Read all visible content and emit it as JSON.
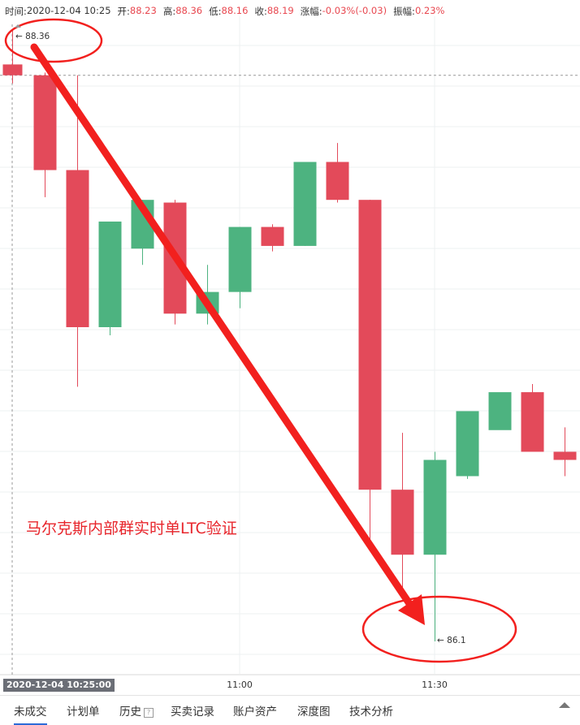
{
  "info_bar": {
    "time_label": "时间:",
    "time_value": "2020-12-04 10:25",
    "open_label": "开:",
    "open_value": "88.23",
    "high_label": "高:",
    "high_value": "88.36",
    "low_label": "低:",
    "low_value": "88.16",
    "close_label": "收:",
    "close_value": "88.19",
    "change_label": "涨幅:",
    "change_value": "-0.03%(-0.03)",
    "amp_label": "振幅:",
    "amp_value": "0.23%"
  },
  "crosshair_time": "2020-12-04 10:25:00",
  "high_marker": "← 88.36",
  "low_marker": "← 86.1",
  "watermark": "马尔克斯内部群实时单LTC验证",
  "colors": {
    "up": "#4db380",
    "down": "#e34a5a",
    "annotation": "#f2201e"
  },
  "tabs": [
    {
      "label": "未成交",
      "active": true
    },
    {
      "label": "计划单",
      "active": false
    },
    {
      "label": "历史",
      "active": false
    },
    {
      "label": "买卖记录",
      "active": false
    },
    {
      "label": "账户资产",
      "active": false
    },
    {
      "label": "深度图",
      "active": false
    },
    {
      "label": "技术分析",
      "active": false
    }
  ],
  "history_help_icon": "?",
  "icons": {
    "collapse": "chevron-up-icon",
    "help": "question-icon"
  },
  "chart_data": {
    "type": "candlestick",
    "interval": "5min",
    "x_ticks": [
      "11:00",
      "11:30"
    ],
    "candles": [
      {
        "t": "10:25",
        "o": 88.23,
        "h": 88.36,
        "l": 88.16,
        "c": 88.19
      },
      {
        "t": "10:30",
        "o": 88.19,
        "h": 88.2,
        "l": 87.74,
        "c": 87.84
      },
      {
        "t": "10:35",
        "o": 87.84,
        "h": 88.19,
        "l": 87.04,
        "c": 87.26
      },
      {
        "t": "10:40",
        "o": 87.26,
        "h": 87.58,
        "l": 87.23,
        "c": 87.65
      },
      {
        "t": "10:45",
        "o": 87.55,
        "h": 87.73,
        "l": 87.49,
        "c": 87.73
      },
      {
        "t": "10:50",
        "o": 87.72,
        "h": 87.73,
        "l": 87.27,
        "c": 87.31
      },
      {
        "t": "10:55",
        "o": 87.31,
        "h": 87.49,
        "l": 87.27,
        "c": 87.39
      },
      {
        "t": "11:00",
        "o": 87.39,
        "h": 87.63,
        "l": 87.33,
        "c": 87.63
      },
      {
        "t": "11:05",
        "o": 87.63,
        "h": 87.64,
        "l": 87.54,
        "c": 87.56
      },
      {
        "t": "11:10",
        "o": 87.56,
        "h": 87.87,
        "l": 87.56,
        "c": 87.87
      },
      {
        "t": "11:15",
        "o": 87.87,
        "h": 87.94,
        "l": 87.72,
        "c": 87.73
      },
      {
        "t": "11:20",
        "o": 87.73,
        "h": 87.73,
        "l": 86.46,
        "c": 86.66
      },
      {
        "t": "11:25",
        "o": 86.66,
        "h": 86.87,
        "l": 86.27,
        "c": 86.42
      },
      {
        "t": "11:30",
        "o": 86.42,
        "h": 86.8,
        "l": 86.1,
        "c": 86.77
      },
      {
        "t": "11:35",
        "o": 86.71,
        "h": 86.77,
        "l": 86.7,
        "c": 86.95
      },
      {
        "t": "11:40",
        "o": 86.88,
        "h": 87.01,
        "l": 86.89,
        "c": 87.02
      },
      {
        "t": "11:45",
        "o": 87.02,
        "h": 87.05,
        "l": 86.86,
        "c": 86.8
      },
      {
        "t": "11:50",
        "o": 86.8,
        "h": 86.89,
        "l": 86.71,
        "c": 86.77
      }
    ]
  }
}
